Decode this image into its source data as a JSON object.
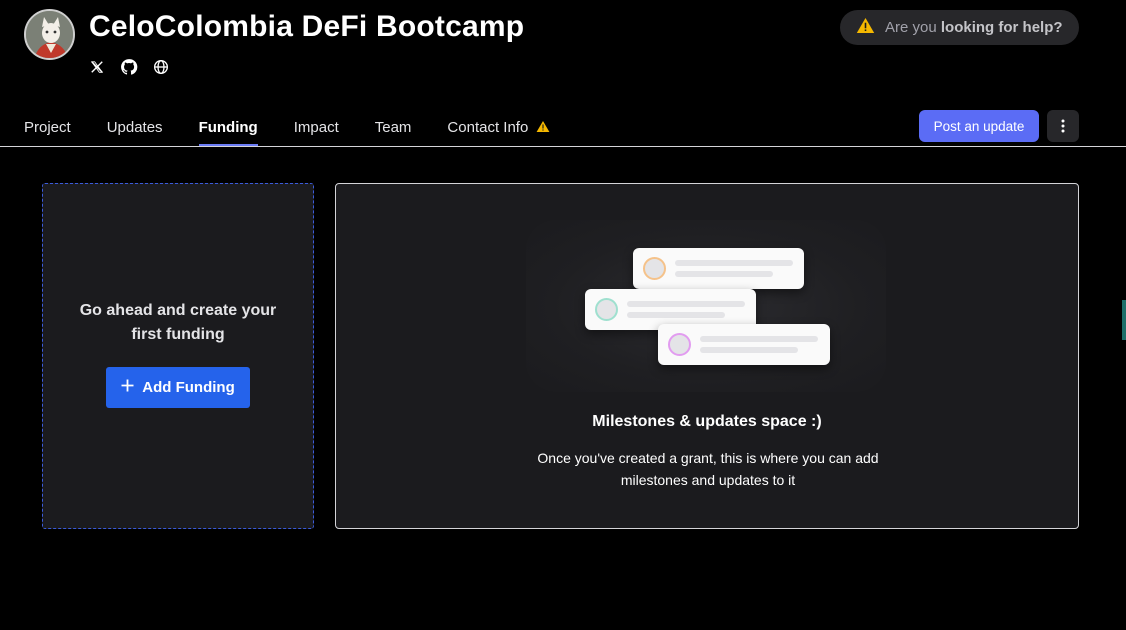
{
  "project": {
    "title": "CeloColombia DeFi Bootcamp",
    "avatar_icon": "cat-portrait-avatar",
    "socials": [
      "x-twitter-icon",
      "github-icon",
      "globe-icon"
    ]
  },
  "help": {
    "prefix": "Are you",
    "emphasis": "looking for help?",
    "icon": "warning-icon"
  },
  "tabs": [
    {
      "label": "Project",
      "active": false
    },
    {
      "label": "Updates",
      "active": false
    },
    {
      "label": "Funding",
      "active": true
    },
    {
      "label": "Impact",
      "active": false
    },
    {
      "label": "Team",
      "active": false
    },
    {
      "label": "Contact Info",
      "active": false,
      "warning": true
    }
  ],
  "actions": {
    "post_update_label": "Post an update",
    "more_icon": "kebab-menu-icon"
  },
  "funding_card": {
    "message": "Go ahead and create your first funding",
    "button_label": "Add Funding"
  },
  "empty_state": {
    "title": "Milestones & updates space :)",
    "body": "Once you've created a grant, this is where you can add milestones and updates to it"
  },
  "colors": {
    "accent": "#5b6cf5",
    "primary_button": "#2563eb",
    "warning": "#f5b800",
    "background": "#000000",
    "card": "#1b1b1e"
  }
}
